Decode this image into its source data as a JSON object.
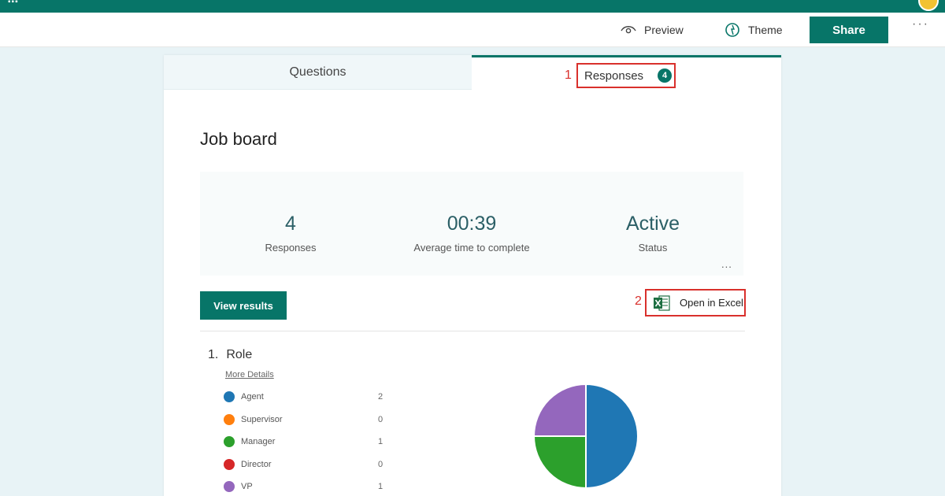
{
  "toolbar": {
    "preview_label": "Preview",
    "theme_label": "Theme",
    "share_label": "Share",
    "more_label": "···"
  },
  "tabs": {
    "questions_label": "Questions",
    "responses_label": "Responses",
    "responses_count": "4"
  },
  "annotations": {
    "marker_1": "1",
    "marker_2": "2"
  },
  "form": {
    "title": "Job board"
  },
  "stats": [
    {
      "value": "4",
      "label": "Responses"
    },
    {
      "value": "00:39",
      "label": "Average time to complete"
    },
    {
      "value": "Active",
      "label": "Status"
    }
  ],
  "actions": {
    "view_results_label": "View results",
    "open_excel_label": "Open in Excel",
    "stats_more_label": "..."
  },
  "question": {
    "number": "1.",
    "title": "Role",
    "more_details_label": "More Details"
  },
  "chart_data": {
    "type": "pie",
    "categories": [
      "Agent",
      "Supervisor",
      "Manager",
      "Director",
      "VP"
    ],
    "values": [
      2,
      0,
      1,
      0,
      1
    ],
    "colors": [
      "#1f77b4",
      "#ff7f0e",
      "#2ca02c",
      "#d62728",
      "#9467bd"
    ]
  },
  "colors": {
    "brand": "#077568",
    "annotation_red": "#d9302c"
  }
}
